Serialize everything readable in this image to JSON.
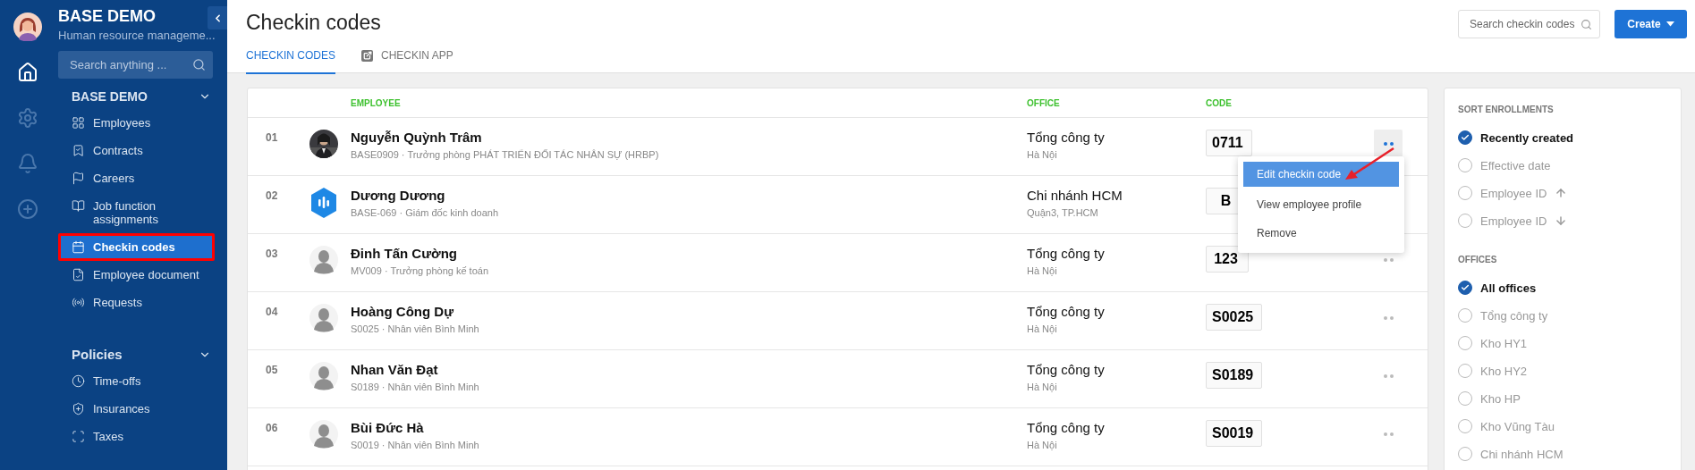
{
  "rail": [
    {
      "selected": true
    },
    {
      "selected": false
    },
    {
      "selected": false
    },
    {
      "selected": false
    }
  ],
  "sidebar": {
    "brand": "BASE DEMO",
    "subtitle": "Human resource manageme...",
    "search_placeholder": "Search anything ...",
    "sections": [
      {
        "title": "BASE DEMO",
        "expanded": true,
        "items": [
          {
            "label": "Employees",
            "selected": false,
            "highlighted": false
          },
          {
            "label": "Contracts",
            "selected": false,
            "highlighted": false
          },
          {
            "label": "Careers",
            "selected": false,
            "highlighted": false
          },
          {
            "label": "Job function assignments",
            "selected": false,
            "highlighted": false
          },
          {
            "label": "Checkin codes",
            "selected": true,
            "highlighted": true
          },
          {
            "label": "Employee document",
            "selected": false,
            "highlighted": false
          },
          {
            "label": "Requests",
            "selected": false,
            "highlighted": false
          }
        ]
      },
      {
        "title": "Policies",
        "expanded": true,
        "items": [
          {
            "label": "Time-offs",
            "selected": false,
            "highlighted": false
          },
          {
            "label": "Insurances",
            "selected": false,
            "highlighted": false
          },
          {
            "label": "Taxes",
            "selected": false,
            "highlighted": false
          }
        ]
      }
    ]
  },
  "header": {
    "title": "Checkin codes",
    "tabs": [
      {
        "label": "CHECKIN CODES",
        "selected": true,
        "kind": "plain"
      },
      {
        "label": "CHECKIN APP",
        "selected": false,
        "kind": "external"
      }
    ],
    "search_placeholder": "Search checkin codes",
    "create_button": "Create"
  },
  "table": {
    "columns": [
      "EMPLOYEE",
      "OFFICE",
      "CODE"
    ],
    "rows": [
      {
        "number": "01",
        "name": "Nguyễn Quỳnh Trâm",
        "subtitle": "BASE0909 · Trưởng phòng PHÁT TRIỂN ĐỐI TÁC NHÂN SỰ (HRBP)",
        "office": "Tổng công ty",
        "location": "Hà Nội",
        "code": "0711",
        "menu_open": true
      },
      {
        "number": "02",
        "kind": "logo",
        "name": "Dương Dương",
        "subtitle": "BASE-069 · Giám đốc kinh doanh",
        "office": "Chi nhánh HCM",
        "location": "Quận3, TP.HCM",
        "code": "B",
        "menu_open": false
      },
      {
        "number": "03",
        "kind": "default",
        "name": "Đinh Tấn Cường",
        "subtitle": "MV009 · Trưởng phòng kế toán",
        "office": "Tổng công ty",
        "location": "Hà Nội",
        "code": "123",
        "menu_open": false
      },
      {
        "number": "04",
        "kind": "default",
        "name": "Hoàng Công Dự",
        "subtitle": "S0025 · Nhân viên Bình Minh",
        "office": "Tổng công ty",
        "location": "Hà Nội",
        "code": "S0025",
        "menu_open": false
      },
      {
        "number": "05",
        "kind": "default",
        "name": "Nhan Văn Đạt",
        "subtitle": "S0189 · Nhân viên Bình Minh",
        "office": "Tổng công ty",
        "location": "Hà Nội",
        "code": "S0189",
        "menu_open": false
      },
      {
        "number": "06",
        "kind": "default",
        "name": "Bùi Đức Hà",
        "subtitle": "S0019 · Nhân viên Bình Minh",
        "office": "Tổng công ty",
        "location": "Hà Nội",
        "code": "S0019",
        "menu_open": false
      }
    ]
  },
  "context_menu": {
    "items": [
      {
        "label": "Edit checkin code",
        "selected": true
      },
      {
        "label": "View employee profile",
        "selected": false
      },
      {
        "label": "Remove",
        "selected": false
      }
    ]
  },
  "filters": [
    {
      "title": "SORT ENROLLMENTS",
      "options": [
        {
          "label": "Recently created",
          "selected": true,
          "kind": "plain"
        },
        {
          "label": "Effective date",
          "selected": false,
          "kind": "plain"
        },
        {
          "label": "Employee ID",
          "selected": false,
          "kind": "ascending"
        },
        {
          "label": "Employee ID",
          "selected": false,
          "kind": "descending"
        }
      ]
    },
    {
      "title": "OFFICES",
      "options": [
        {
          "label": "All offices",
          "selected": true
        },
        {
          "label": "Tổng công ty",
          "selected": false
        },
        {
          "label": "Kho HY1",
          "selected": false
        },
        {
          "label": "Kho HY2",
          "selected": false
        },
        {
          "label": "Kho HP",
          "selected": false
        },
        {
          "label": "Kho Vũng Tàu",
          "selected": false
        },
        {
          "label": "Chi nhánh HCM",
          "selected": false
        }
      ]
    }
  ]
}
